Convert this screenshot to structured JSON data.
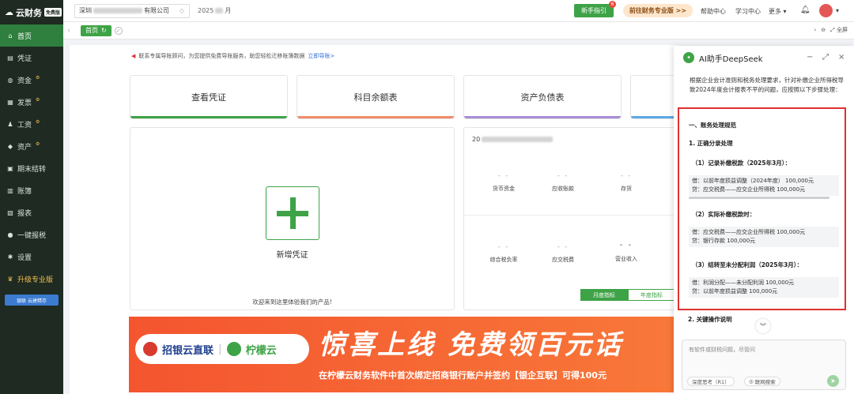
{
  "app": {
    "logo_text": "云财务",
    "logo_badge": "免费版"
  },
  "sidebar": {
    "items": [
      {
        "label": "首页",
        "icon": "home-icon",
        "glyph": "⌂",
        "active": true
      },
      {
        "label": "凭证",
        "icon": "voucher-icon",
        "glyph": "▤"
      },
      {
        "label": "资金",
        "icon": "fund-icon",
        "glyph": "◍",
        "dot": "⚙"
      },
      {
        "label": "发票",
        "icon": "invoice-icon",
        "glyph": "▦",
        "dot": "⚙"
      },
      {
        "label": "工资",
        "icon": "salary-icon",
        "glyph": "♟",
        "dot": "⚙"
      },
      {
        "label": "资产",
        "icon": "asset-icon",
        "glyph": "◆",
        "dot": "⚙"
      },
      {
        "label": "期末结转",
        "icon": "closing-icon",
        "glyph": "▣"
      },
      {
        "label": "账簿",
        "icon": "ledger-icon",
        "glyph": "▥"
      },
      {
        "label": "报表",
        "icon": "report-icon",
        "glyph": "▧"
      },
      {
        "label": "一键报税",
        "icon": "tax-icon",
        "glyph": "●"
      },
      {
        "label": "设置",
        "icon": "settings-icon",
        "glyph": "✱"
      },
      {
        "label": "升级专业版",
        "icon": "upgrade-icon",
        "glyph": "♛",
        "upgrade": true
      }
    ],
    "promo": "银联 云建精存"
  },
  "topbar": {
    "company": "深圳",
    "company_suffix": "有限公司",
    "period_prefix": "2025",
    "period_suffix": "月",
    "guide_label": "新手指引",
    "guide_badge": "6",
    "pro_label": "前往财务专业版 >>",
    "links": {
      "help": "帮助中心",
      "learn": "学习中心",
      "more": "更多"
    }
  },
  "tabbar": {
    "home_tab": "首页",
    "fullscreen": "全屏"
  },
  "main": {
    "notice_text": "联系专属导账顾问，为您提供免费导账服务，助您轻松迁移账簿数据",
    "notice_link": "立即导账>",
    "quick": [
      {
        "label": "查看凭证",
        "color": "#3ea347"
      },
      {
        "label": "科目余额表",
        "color": "#f08b6a"
      },
      {
        "label": "资产负债表",
        "color": "#a78bd6"
      },
      {
        "label": "",
        "color": "#5ba9e6"
      }
    ],
    "new_voucher_label": "新增凭证",
    "welcome_text": "欢迎来到这里体验我们的产品!",
    "stats_title_prefix": "20",
    "stats": [
      {
        "value": "- -",
        "label": "货币资金"
      },
      {
        "value": "- -",
        "label": "应收账款"
      },
      {
        "value": "- -",
        "label": "存货"
      },
      {
        "value": "- -",
        "label": "综合税负率"
      },
      {
        "value": "- -",
        "label": "应交税费"
      },
      {
        "value": "- -",
        "label": "营业收入"
      }
    ],
    "toggle": {
      "monthly": "月度指标",
      "yearly": "年度指标"
    },
    "banner": {
      "logo1": "招银云直联",
      "logo2": "柠檬云",
      "title": "惊喜上线  免费领百元话",
      "subtitle": "在柠檬云财务软件中首次绑定招商银行账户并签约【银企互联】可得100元"
    }
  },
  "ai": {
    "title": "AI助手DeepSeek",
    "intro": "根据企业会计准则和税务处理要求，针对补缴企业所得税导致2024年度会计报表不平的问题，应按照以下步骤处理：",
    "section1": "一、账务处理规范",
    "sub1": "1. 正确分录处理",
    "step1": "（1）记录补缴税款（2025年3月）：",
    "code1": [
      "借：以前年度损益调整（2024年度）    100,000元",
      "贷：应交税费——应交企业所得税         100,000元"
    ],
    "step2": "（2）实际补缴税款时：",
    "code2": [
      "借：应交税费——应交企业所得税     100,000元",
      "贷：银行存款                          100,000元"
    ],
    "step3": "（3）结转至未分配利润（2025年3月）：",
    "code3": [
      "借：利润分配——未分配利润    100,000元",
      "贷：以前年度损益调整           100,000元"
    ],
    "more": "2. 关键操作说明",
    "placeholder": "有软件或财税问题，尽管问",
    "chip_think": "深度思考（R1）",
    "chip_search": "联网搜索"
  }
}
